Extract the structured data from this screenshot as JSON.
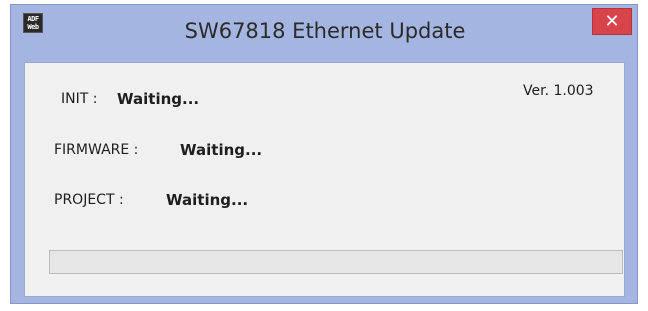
{
  "window": {
    "title": "SW67818 Ethernet Update",
    "close_glyph": "✕",
    "icon_lines": [
      "ADF",
      "Web"
    ]
  },
  "status": {
    "init_label": "INIT :",
    "init_value": "Waiting...",
    "firmware_label": "FIRMWARE :",
    "firmware_value": "Waiting...",
    "project_label": "PROJECT :",
    "project_value": "Waiting...",
    "version": "Ver. 1.003"
  },
  "progress": {
    "value_percent": 0
  },
  "colors": {
    "frame": "#a5b5e1",
    "close": "#d74449",
    "client": "#f0f0f0"
  }
}
